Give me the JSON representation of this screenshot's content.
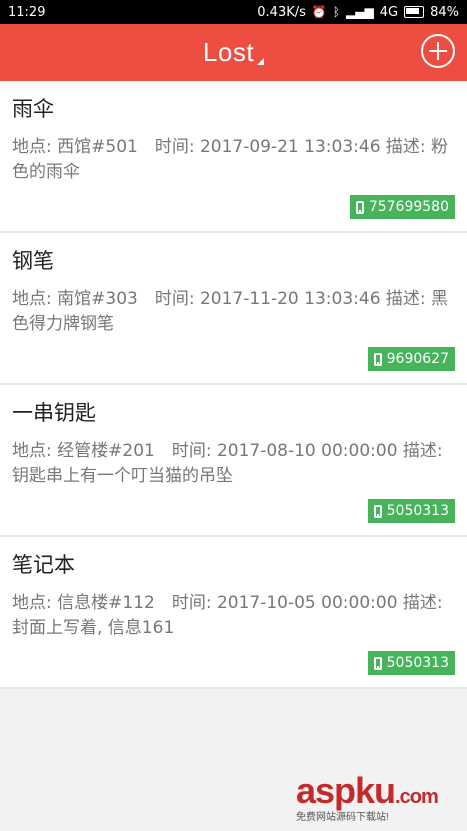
{
  "status_bar": {
    "time": "11:29",
    "network_speed": "0.43K/s",
    "network_type": "4G",
    "battery": "84%"
  },
  "app_bar": {
    "title": "Lost"
  },
  "items": [
    {
      "title": "雨伞",
      "details": "地点: 西馆#501　时间: 2017-09-21 13:03:46 描述: 粉色的雨伞",
      "phone": "757699580"
    },
    {
      "title": "钢笔",
      "details": "地点: 南馆#303　时间: 2017-11-20 13:03:46 描述: 黑色得力牌钢笔",
      "phone": "9690627"
    },
    {
      "title": "一串钥匙",
      "details": "地点: 经管楼#201　时间: 2017-08-10 00:00:00 描述: 钥匙串上有一个叮当猫的吊坠",
      "phone": "5050313"
    },
    {
      "title": "笔记本",
      "details": "地点: 信息楼#112　时间: 2017-10-05 00:00:00 描述: 封面上写着, 信息161",
      "phone": "5050313"
    }
  ],
  "watermark": {
    "brand": "aspku",
    "suffix": ".com",
    "tagline": "免费网站源码下载站!"
  },
  "colors": {
    "app_bar": "#ee4d41",
    "phone_badge": "#47b35a",
    "watermark": "#c52a2a"
  }
}
